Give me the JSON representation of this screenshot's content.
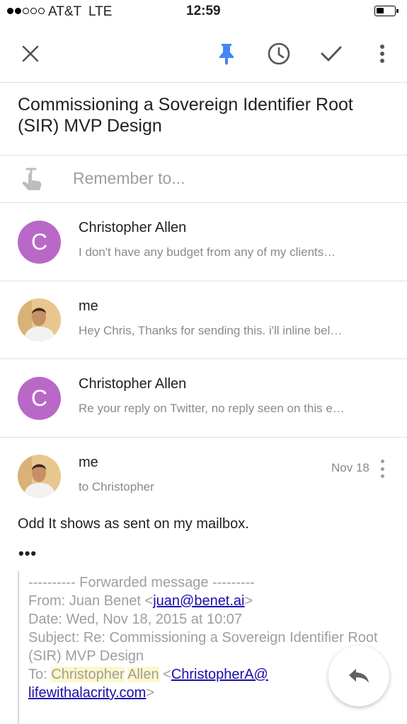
{
  "status_bar": {
    "carrier": "AT&T",
    "network": "LTE",
    "time": "12:59",
    "signal_bars_filled": 2,
    "signal_bars_total": 5,
    "battery_level": 0.35
  },
  "toolbar": {
    "close_icon": "close-icon",
    "pin_icon": "pin-icon",
    "snooze_icon": "clock-icon",
    "done_icon": "checkmark-icon",
    "more_icon": "more-vert-icon",
    "pin_color": "#4285f4"
  },
  "email": {
    "subject": "Commissioning a Sovereign Identifier Root (SIR) MVP Design"
  },
  "reminder": {
    "placeholder": "Remember to..."
  },
  "thread": [
    {
      "sender": "Christopher Allen",
      "initial": "C",
      "snippet": "I don't have any budget from any of my clients…"
    },
    {
      "sender": "me",
      "snippet": "Hey Chris, Thanks for sending this. i'll inline bel…"
    },
    {
      "sender": "Christopher Allen",
      "initial": "C",
      "snippet": "Re your reply on Twitter, no reply seen on this e…"
    }
  ],
  "open_message": {
    "sender": "me",
    "to": "to Christopher",
    "date": "Nov 18",
    "body": "Odd It shows as sent on my mailbox.",
    "collapsed_quote": "•••",
    "forwarded": {
      "header": "---------- Forwarded message ---------",
      "from_label": "From: Juan Benet <",
      "from_email": "juan@benet.ai",
      "from_close": ">",
      "date": "Date: Wed, Nov 18, 2015 at 10:07",
      "subject": "Subject: Re: Commissioning a Sovereign Identifier Root (SIR) MVP Design",
      "to_label": "To: ",
      "to_first": "Christopher",
      "to_last": "Allen",
      "to_open": " <",
      "to_email_1": "ChristopherA@",
      "to_email_2": "lifewithalacrity.com",
      "to_close": ">"
    }
  },
  "colors": {
    "avatar_purple": "#ba68c8",
    "link": "#1a0dab",
    "highlight": "#fdf8c9",
    "accent_blue": "#4285f4"
  }
}
